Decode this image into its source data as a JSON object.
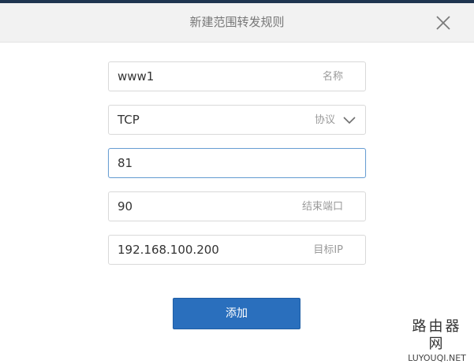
{
  "dialog": {
    "title": "新建范围转发规则"
  },
  "form": {
    "name_field": {
      "value": "www1",
      "label": "名称"
    },
    "protocol_field": {
      "value": "TCP",
      "label": "协议"
    },
    "start_port_field": {
      "value": "81"
    },
    "end_port_field": {
      "value": "90",
      "label": "结束端口"
    },
    "target_ip_field": {
      "value": "192.168.100.200",
      "label": "目标IP"
    }
  },
  "actions": {
    "add_label": "添加"
  },
  "watermark": {
    "cn": "路由器网",
    "en": "LUYOUQI.NET"
  },
  "colors": {
    "primary_button": "#2a6fbd",
    "focus_border": "#6a9fd3",
    "header_background": "#f2f2f2"
  }
}
